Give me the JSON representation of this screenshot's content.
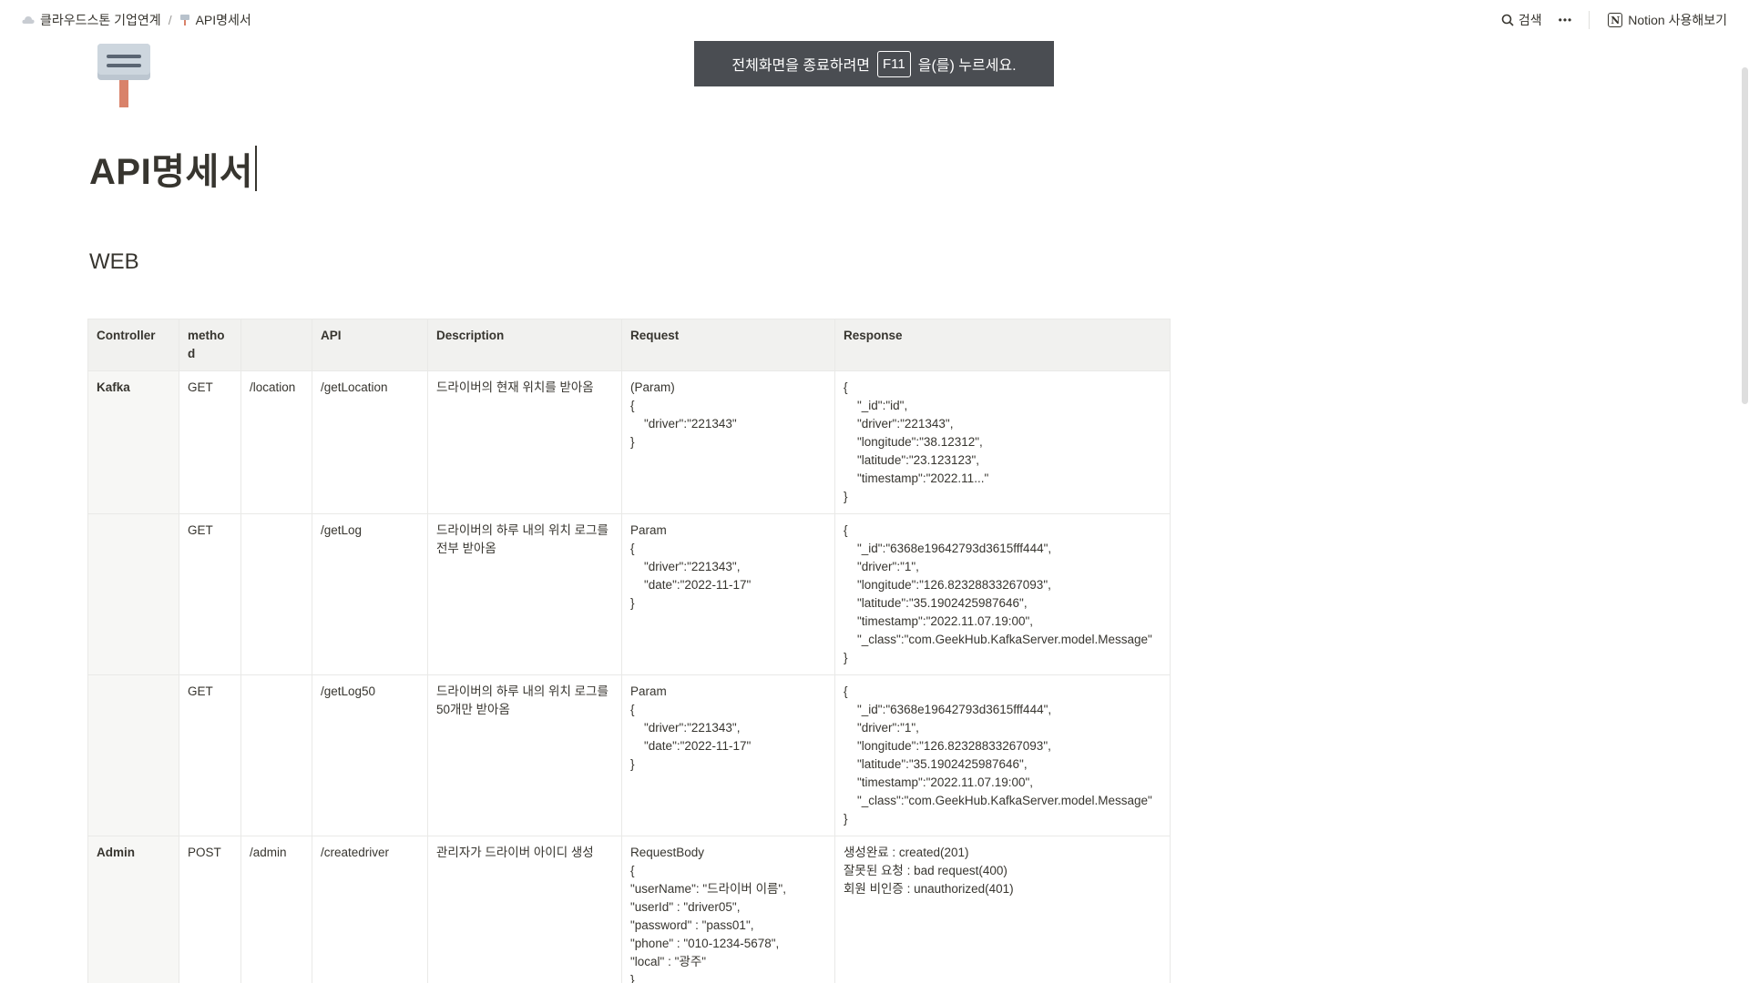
{
  "breadcrumb": {
    "workspace": "클라우드스톤 기업연계",
    "separator": "/",
    "page": "API명세서"
  },
  "topbar": {
    "search_label": "검색",
    "more_label": "•••",
    "notion_label": "Notion 사용해보기"
  },
  "toast": {
    "prefix": "전체화면을 종료하려면",
    "key": "F11",
    "suffix": "을(를) 누르세요."
  },
  "page": {
    "title": "API명세서",
    "section_heading": "WEB"
  },
  "table": {
    "headers": [
      "Controller",
      "metho d",
      "",
      "API",
      "Description",
      "Request",
      "Response"
    ],
    "rows": [
      {
        "controller": "Kafka",
        "method": "GET",
        "path": "/location",
        "api": "/getLocation",
        "description": "드라이버의 현재 위치를 받아옴",
        "request": [
          "(Param)",
          "{",
          "    \"driver\":\"221343\"",
          "}"
        ],
        "response": [
          "{",
          "    \"_id\":\"id\",",
          "    \"driver\":\"221343\",",
          "    \"longitude\":\"38.12312\",",
          "    \"latitude\":\"23.123123\",",
          "    \"timestamp\":\"2022.11...\"",
          "}"
        ]
      },
      {
        "controller": "",
        "method": "GET",
        "path": "",
        "api": "/getLog",
        "description": "드라이버의 하루 내의 위치 로그를 전부 받아옴",
        "request": [
          "Param",
          "{",
          "    \"driver\":\"221343\",",
          "    \"date\":\"2022-11-17\"",
          "}"
        ],
        "response": [
          "{",
          "    \"_id\":\"6368e19642793d3615fff444\",",
          "    \"driver\":\"1\",",
          "    \"longitude\":\"126.82328833267093\",",
          "    \"latitude\":\"35.1902425987646\",",
          "    \"timestamp\":\"2022.11.07.19:00\",",
          "    \"_class\":\"com.GeekHub.KafkaServer.model.Message\"",
          "}"
        ]
      },
      {
        "controller": "",
        "method": "GET",
        "path": "",
        "api": "/getLog50",
        "description": "드라이버의 하루 내의 위치 로그를 50개만 받아옴",
        "request": [
          "Param",
          "{",
          "    \"driver\":\"221343\",",
          "    \"date\":\"2022-11-17\"",
          "}"
        ],
        "response": [
          "{",
          "    \"_id\":\"6368e19642793d3615fff444\",",
          "    \"driver\":\"1\",",
          "    \"longitude\":\"126.82328833267093\",",
          "    \"latitude\":\"35.1902425987646\",",
          "    \"timestamp\":\"2022.11.07.19:00\",",
          "    \"_class\":\"com.GeekHub.KafkaServer.model.Message\"",
          "}"
        ]
      },
      {
        "controller": "Admin",
        "method": "POST",
        "path": "/admin",
        "api": "/createdriver",
        "description": "관리자가 드라이버 아이디 생성",
        "request": [
          "RequestBody",
          "{",
          "\"userName\": \"드라이버 이름\",",
          "\"userId\" : \"driver05\",",
          "\"password\" : \"pass01\",",
          "\"phone\" : \"010-1234-5678\",",
          "\"local\" : \"광주\"",
          "}"
        ],
        "response": [
          "생성완료 : created(201)",
          "잘못된 요청 : bad request(400)",
          "회원 비인증 : unauthorized(401)"
        ]
      }
    ]
  }
}
